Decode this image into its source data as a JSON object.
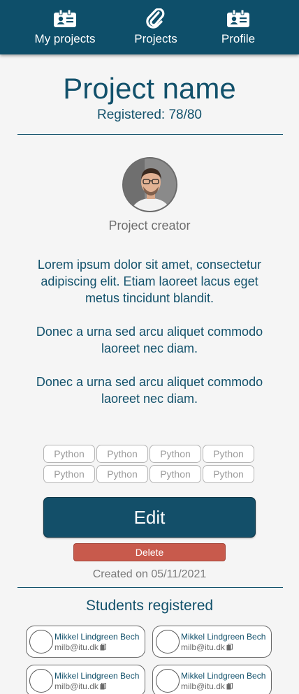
{
  "nav": {
    "items": [
      {
        "label": "My projects",
        "icon": "id-card-icon"
      },
      {
        "label": "Projects",
        "icon": "paperclip-icon"
      },
      {
        "label": "Profile",
        "icon": "id-card-icon"
      }
    ]
  },
  "project": {
    "name": "Project name",
    "registered": "Registered: 78/80",
    "creator_label": "Project creator",
    "description": [
      "Lorem ipsum dolor sit amet, consectetur adipiscing elit. Etiam laoreet lacus eget metus tincidunt blandit.",
      "Donec a urna sed arcu aliquet commodo laoreet nec diam.",
      "Donec a urna sed arcu aliquet commodo laoreet nec diam."
    ],
    "tags": [
      "Python",
      "Python",
      "Python",
      "Python",
      "Python",
      "Python",
      "Python",
      "Python"
    ],
    "edit_label": "Edit",
    "delete_label": "Delete",
    "created": "Created on 05/11/2021"
  },
  "students": {
    "title": "Students registered",
    "list": [
      {
        "name": "Mikkel Lindgreen Bech",
        "email": "milb@itu.dk"
      },
      {
        "name": "Mikkel Lindgreen Bech",
        "email": "milb@itu.dk"
      },
      {
        "name": "Mikkel Lindgreen Bech",
        "email": "milb@itu.dk"
      },
      {
        "name": "Mikkel Lindgreen Bech",
        "email": "milb@itu.dk"
      }
    ]
  },
  "colors": {
    "primary": "#0e4f6a",
    "delete": "#c85a4c",
    "background": "#f5f5f5"
  }
}
